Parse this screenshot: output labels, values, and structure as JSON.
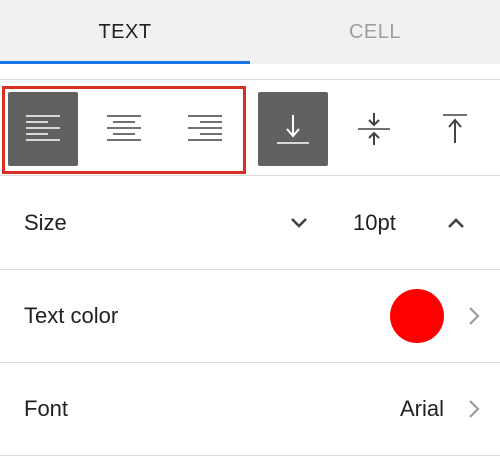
{
  "tabs": [
    {
      "label": "TEXT",
      "active": true
    },
    {
      "label": "CELL",
      "active": false
    }
  ],
  "alignment": {
    "horizontal": [
      {
        "name": "align-left",
        "icon": "align-left-icon",
        "selected": true
      },
      {
        "name": "align-center",
        "icon": "align-center-icon",
        "selected": false
      },
      {
        "name": "align-right",
        "icon": "align-right-icon",
        "selected": false
      }
    ],
    "vertical": [
      {
        "name": "align-bottom",
        "icon": "align-bottom-icon",
        "selected": true
      },
      {
        "name": "align-middle",
        "icon": "align-middle-icon",
        "selected": false
      },
      {
        "name": "align-top",
        "icon": "align-top-icon",
        "selected": false
      }
    ]
  },
  "size": {
    "label": "Size",
    "value": "10pt",
    "decrease_icon": "chevron-down-icon",
    "increase_icon": "chevron-up-icon"
  },
  "text_color": {
    "label": "Text color",
    "color": "#ff0000",
    "chevron_icon": "chevron-right-icon"
  },
  "font": {
    "label": "Font",
    "value": "Arial",
    "chevron_icon": "chevron-right-icon"
  },
  "colors": {
    "accent": "#1a73e8",
    "selected_bg": "#616161",
    "highlight_border": "#d93025"
  }
}
